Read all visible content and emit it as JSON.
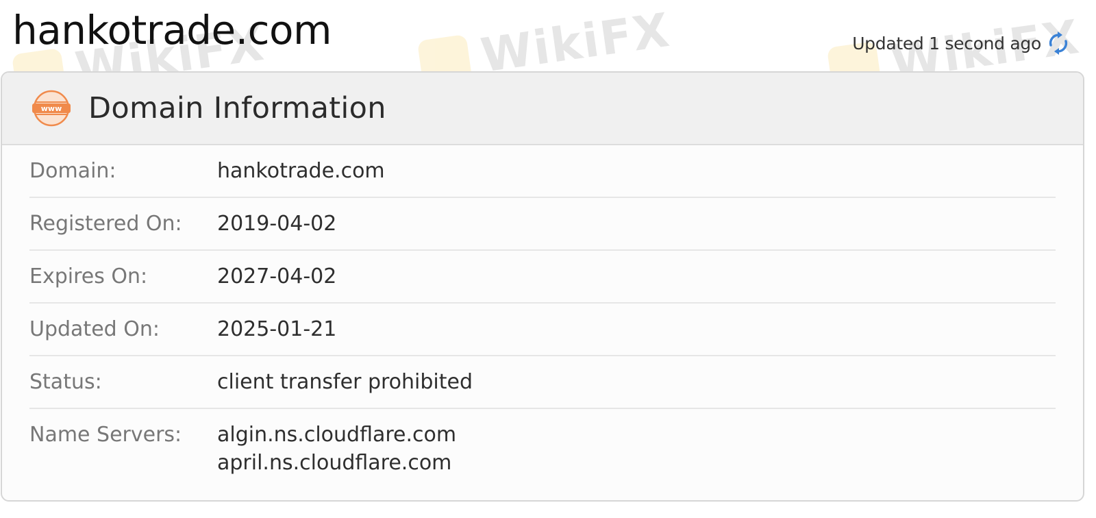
{
  "header": {
    "title": "hankotrade.com",
    "updated_text": "Updated 1 second ago",
    "refresh_icon": "refresh-icon"
  },
  "panel": {
    "icon": "www-icon",
    "icon_text": "www",
    "title": "Domain Information",
    "rows": [
      {
        "label": "Domain:",
        "value": "hankotrade.com"
      },
      {
        "label": "Registered On:",
        "value": "2019-04-02"
      },
      {
        "label": "Expires On:",
        "value": "2027-04-02"
      },
      {
        "label": "Updated On:",
        "value": "2025-01-21"
      },
      {
        "label": "Status:",
        "value": "client transfer prohibited"
      }
    ],
    "name_servers": {
      "label": "Name Servers:",
      "values": [
        "algin.ns.cloudflare.com",
        "april.ns.cloudflare.com"
      ]
    }
  },
  "watermark": {
    "text": "WikiFX",
    "color": "#f2b400"
  },
  "colors": {
    "accent_orange": "#f08a4b",
    "refresh_blue": "#3b82d6",
    "heading_bg": "#f0f0f0"
  }
}
